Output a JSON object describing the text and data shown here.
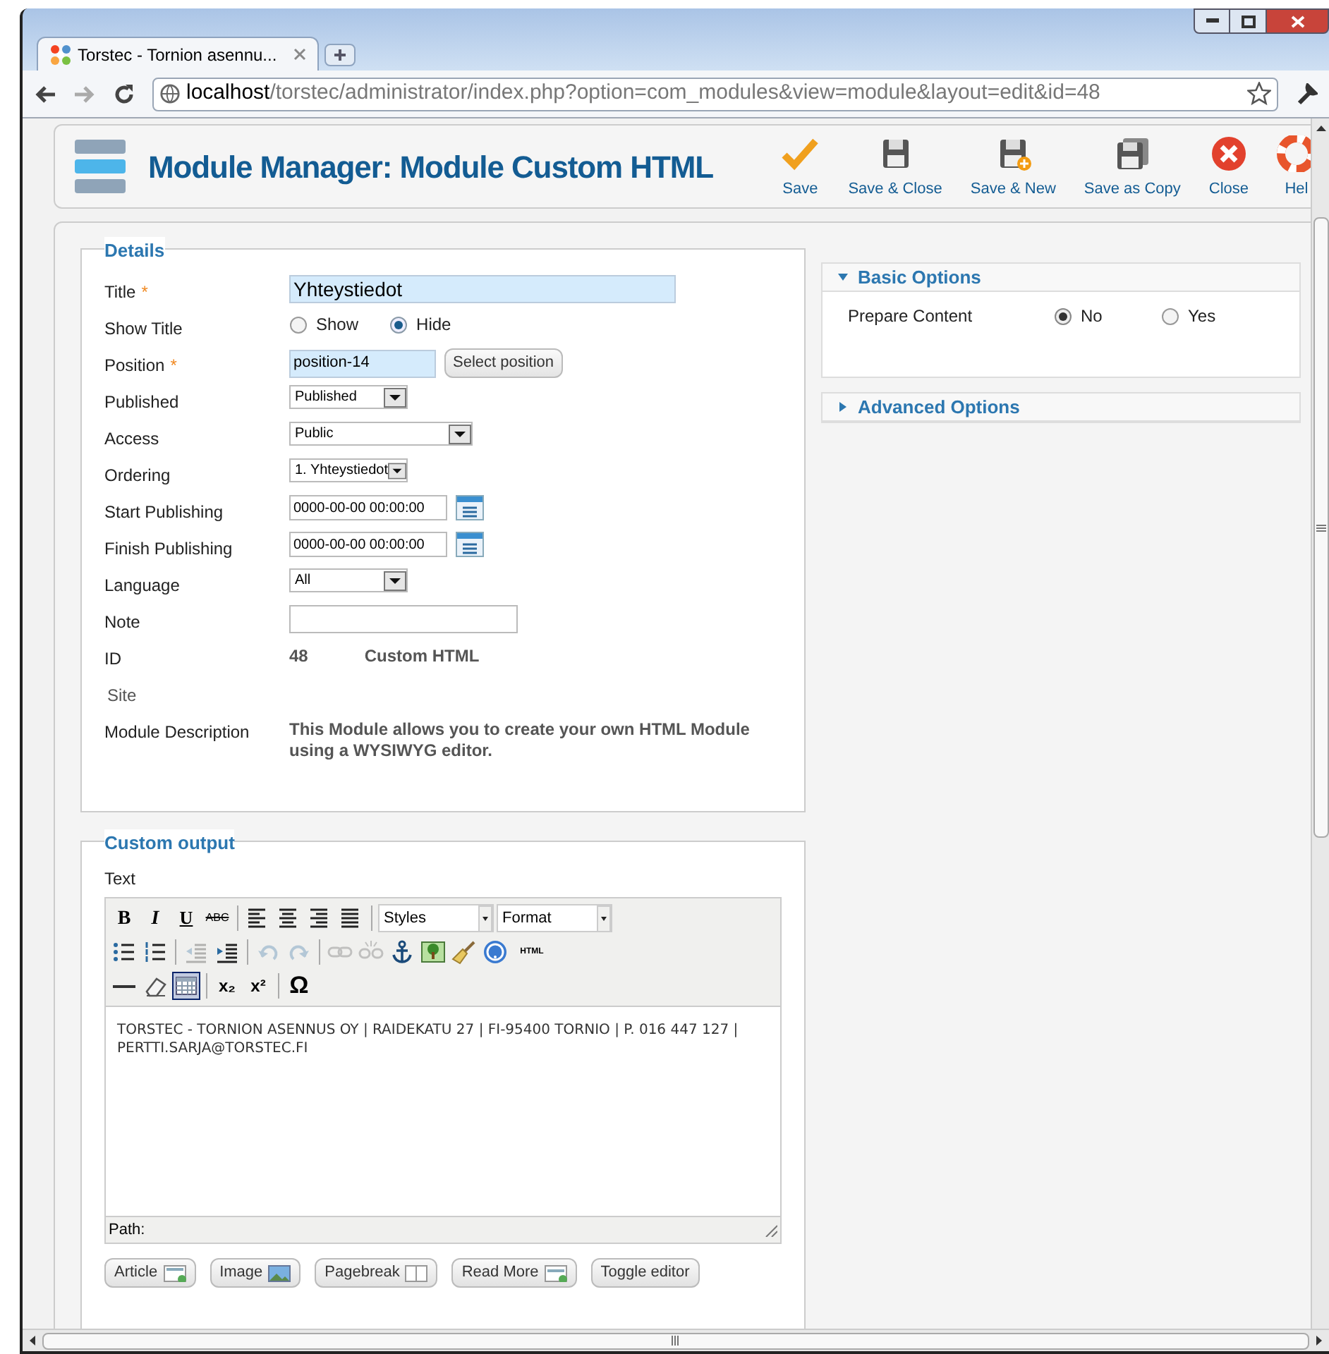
{
  "browser": {
    "tab_title": "Torstec - Tornion asennu...",
    "address_host": "localhost",
    "address_path": "/torstec/administrator/index.php?option=com_modules&view=module&layout=edit&id=48"
  },
  "toolbar": {
    "title": "Module Manager: Module Custom HTML",
    "buttons": [
      {
        "kind": "save",
        "label": "Save"
      },
      {
        "kind": "save-close",
        "label": "Save & Close"
      },
      {
        "kind": "save-new",
        "label": "Save & New"
      },
      {
        "kind": "save-copy",
        "label": "Save as Copy"
      },
      {
        "kind": "close",
        "label": "Close"
      },
      {
        "kind": "help",
        "label": "Hel"
      }
    ]
  },
  "details": {
    "legend": "Details",
    "fields": [
      {
        "kind": "text",
        "label": "Title",
        "required_mark": "*",
        "value": "Yhteystiedot",
        "highlighted": true
      },
      {
        "kind": "radio",
        "label": "Show Title",
        "options": [
          {
            "label": "Show",
            "selected": false
          },
          {
            "label": "Hide",
            "selected": true
          }
        ]
      },
      {
        "kind": "text",
        "label": "Position",
        "required_mark": "*",
        "value": "position-14",
        "highlighted": true,
        "button": "Select position"
      },
      {
        "kind": "select",
        "label": "Published",
        "value": "Published"
      },
      {
        "kind": "select",
        "label": "Access",
        "value": "Public"
      },
      {
        "kind": "select",
        "label": "Ordering",
        "value": "1. Yhteystiedot"
      },
      {
        "kind": "date",
        "label": "Start Publishing",
        "value": "0000-00-00 00:00:00"
      },
      {
        "kind": "date",
        "label": "Finish Publishing",
        "value": "0000-00-00 00:00:00"
      },
      {
        "kind": "select",
        "label": "Language",
        "value": "All"
      },
      {
        "kind": "text",
        "label": "Note",
        "highlighted": false
      },
      {
        "kind": "static",
        "label": "ID",
        "value": "48",
        "extra": "Custom HTML"
      },
      {
        "kind": "note",
        "label": "Site"
      },
      {
        "kind": "static",
        "label": "Module Description",
        "value": "This Module allows you to create your own HTML Module using a WYSIWYG editor."
      }
    ]
  },
  "custom_output": {
    "legend": "Custom output",
    "label": "Text",
    "editor": {
      "rows": [
        [
          {
            "kind": "bold",
            "text": "B",
            "disabled": false,
            "active": false
          },
          {
            "kind": "italic",
            "text": "I",
            "disabled": false,
            "active": false
          },
          {
            "kind": "underline",
            "text": "U",
            "disabled": false,
            "active": false
          },
          {
            "kind": "strike",
            "text": "ABC",
            "disabled": false,
            "active": false
          },
          {
            "kind": "separator"
          },
          {
            "kind": "align-left",
            "disabled": false,
            "active": false
          },
          {
            "kind": "align-center",
            "disabled": false,
            "active": false
          },
          {
            "kind": "align-right",
            "disabled": false,
            "active": false
          },
          {
            "kind": "justify",
            "disabled": false,
            "active": false
          },
          {
            "kind": "separator"
          },
          {
            "kind": "dropdown",
            "text": "Styles"
          },
          {
            "kind": "dropdown",
            "text": "Format"
          }
        ],
        [
          {
            "kind": "bullets",
            "disabled": false,
            "active": false
          },
          {
            "kind": "numbers",
            "disabled": false,
            "active": false
          },
          {
            "kind": "separator"
          },
          {
            "kind": "outdent",
            "disabled": true,
            "active": false
          },
          {
            "kind": "indent",
            "disabled": false,
            "active": false
          },
          {
            "kind": "separator"
          },
          {
            "kind": "undo",
            "disabled": true,
            "active": false
          },
          {
            "kind": "redo",
            "disabled": true,
            "active": false
          },
          {
            "kind": "separator"
          },
          {
            "kind": "link",
            "disabled": true,
            "active": false
          },
          {
            "kind": "unlink",
            "disabled": true,
            "active": false
          },
          {
            "kind": "anchor",
            "disabled": false,
            "active": false
          },
          {
            "kind": "image",
            "disabled": false,
            "active": false
          },
          {
            "kind": "cleanup",
            "disabled": false,
            "active": false
          },
          {
            "kind": "help",
            "disabled": false,
            "active": false
          },
          {
            "kind": "html",
            "text": "HTML",
            "disabled": false,
            "active": false
          }
        ],
        [
          {
            "kind": "hr",
            "disabled": false,
            "active": false
          },
          {
            "kind": "eraser",
            "disabled": false,
            "active": false
          },
          {
            "kind": "table",
            "disabled": false,
            "active": true
          },
          {
            "kind": "separator"
          },
          {
            "kind": "sub",
            "text": "x₂",
            "disabled": false,
            "active": false
          },
          {
            "kind": "sup",
            "text": "x²",
            "disabled": false,
            "active": false
          },
          {
            "kind": "separator"
          },
          {
            "kind": "charmap",
            "text": "Ω",
            "disabled": false,
            "active": false
          }
        ]
      ],
      "content": "TORSTEC - TORNION ASENNUS OY | RAIDEKATU 27 | FI-95400 TORNIO | P. 016 447 127 | PERTTI.SARJA@TORSTEC.FI",
      "path": "Path:"
    },
    "buttons": [
      {
        "kind": "article",
        "label": "Article"
      },
      {
        "kind": "image",
        "label": "Image"
      },
      {
        "kind": "pagebreak",
        "label": "Pagebreak"
      },
      {
        "kind": "readmore",
        "label": "Read More"
      },
      {
        "kind": "plain",
        "label": "Toggle editor"
      }
    ]
  },
  "options": [
    {
      "title": "Basic Options",
      "expanded": true,
      "fields": [
        {
          "label": "Prepare Content",
          "options": [
            {
              "label": "No",
              "selected": true
            },
            {
              "label": "Yes",
              "selected": false
            }
          ]
        }
      ]
    },
    {
      "title": "Advanced Options",
      "expanded": false
    }
  ]
}
